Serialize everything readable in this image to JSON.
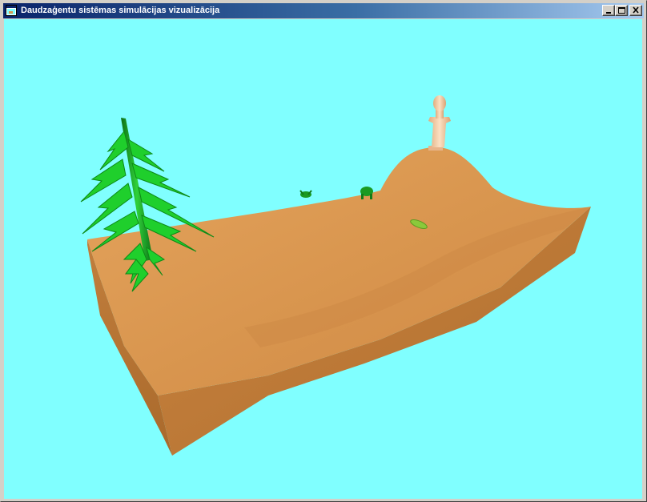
{
  "window": {
    "title": "Daudzaģentu sistēmas simulācijas vizualizācija",
    "controls": {
      "minimize": "minimize-icon",
      "maximize": "maximize-icon",
      "close": "close-icon"
    }
  },
  "colors": {
    "title_active_start": "#0a246a",
    "title_active_end": "#a6caf0",
    "viewport_background": "#80ffff",
    "terrain_top": "#d9964f",
    "terrain_side": "#b87532",
    "tree_green": "#1fbf2a",
    "agent_green": "#1a9a22",
    "statue": "#f0c49a"
  },
  "scene": {
    "objects": [
      "tree",
      "statue",
      "frog-agent",
      "frog-agent",
      "leaf"
    ]
  }
}
